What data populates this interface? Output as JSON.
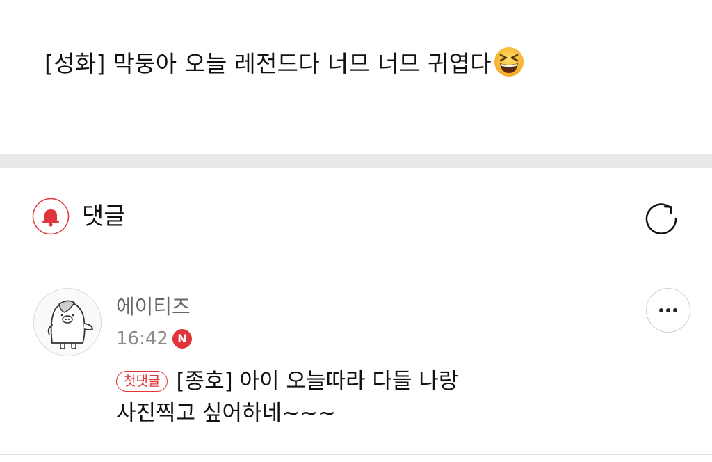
{
  "post": {
    "title": "[성화] 막둥아 오늘 레전드다 너므 너므 귀엽다",
    "emoji": "grinning-squinting-face-icon"
  },
  "comments_section": {
    "title": "댓글",
    "bell_icon": "bell-icon",
    "refresh_icon": "refresh-icon"
  },
  "comments": [
    {
      "author": "에이티즈",
      "time": "16:42",
      "new_badge": "N",
      "first_comment_badge": "첫댓글",
      "text_line1": "[종호] 아이 오늘따라 다들 나랑",
      "text_line2": "사진찍고 싶어하네~~~"
    }
  ],
  "colors": {
    "accent": "#e0353a",
    "divider": "#e9e9e9",
    "muted_text": "#8a8a8a"
  }
}
